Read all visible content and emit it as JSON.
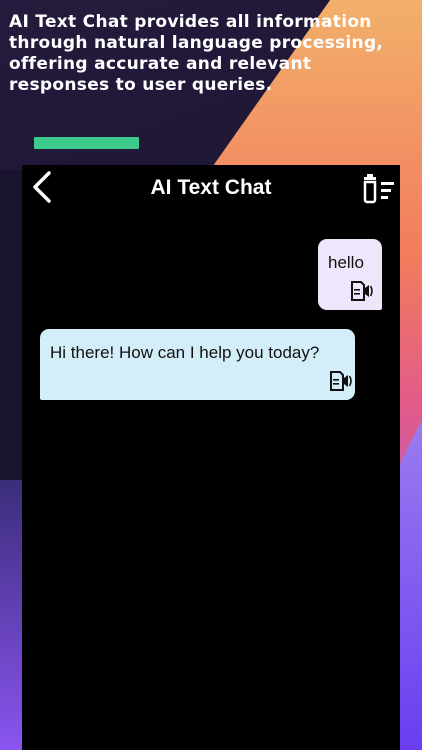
{
  "promo": {
    "headline": "AI Text Chat provides all information through natural language processing, offering accurate and relevant responses to user queries.",
    "accent_color": "#3ec98d"
  },
  "header": {
    "title": "AI Text Chat",
    "back_icon": "chevron-left-icon",
    "clear_icon": "trash-list-icon"
  },
  "messages": [
    {
      "role": "user",
      "text": "hello",
      "bubble_color": "#f0e6fb",
      "action_icon": "speaker-icon"
    },
    {
      "role": "assistant",
      "text": "Hi there! How can I help you today?",
      "bubble_color": "#d3eef9",
      "action_icon": "speaker-icon"
    }
  ]
}
